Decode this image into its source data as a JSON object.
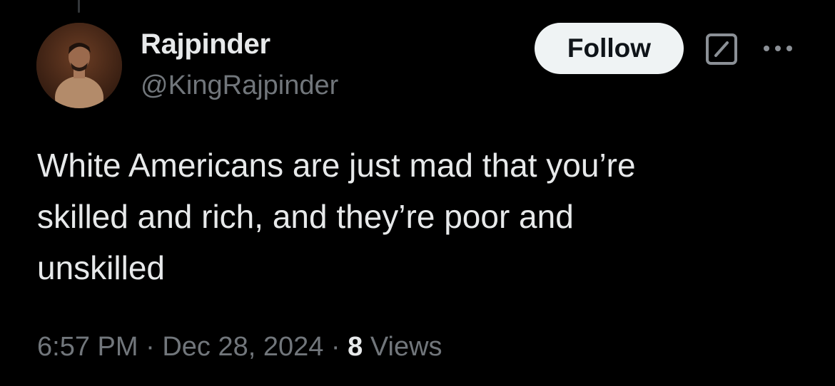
{
  "user": {
    "display_name": "Rajpinder",
    "handle": "@KingRajpinder"
  },
  "actions": {
    "follow_label": "Follow",
    "grok_icon": "grok-icon",
    "more_icon": "more-icon"
  },
  "tweet": {
    "text": "White Americans are just mad that you’re\nskilled and rich, and they’re poor and\nunskilled",
    "time": "6:57 PM",
    "separator": " · ",
    "date": "Dec 28, 2024",
    "views_count": "8",
    "views_label": " Views"
  },
  "colors": {
    "background": "#000000",
    "primary_text": "#e7e9ea",
    "secondary_text": "#71767b",
    "follow_bg": "#eff3f4",
    "follow_text": "#0f1419"
  }
}
